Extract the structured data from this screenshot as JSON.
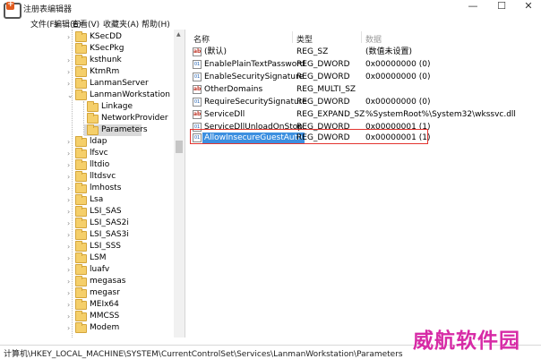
{
  "window": {
    "title": "注册表编辑器",
    "minimize_glyph": "—",
    "maximize_glyph": "☐",
    "close_glyph": "✕"
  },
  "menu": [
    "文件(F)",
    "编辑(E)",
    "查看(V)",
    "收藏夹(A)",
    "帮助(H)"
  ],
  "tree": {
    "nodes": [
      {
        "label": "KSecDD",
        "expander": "›"
      },
      {
        "label": "KSecPkg",
        "expander": ""
      },
      {
        "label": "ksthunk",
        "expander": "›"
      },
      {
        "label": "KtmRm",
        "expander": "›"
      },
      {
        "label": "LanmanServer",
        "expander": "›"
      },
      {
        "label": "LanmanWorkstation",
        "expander": "⌄"
      },
      {
        "label": "Linkage",
        "expander": ""
      },
      {
        "label": "NetworkProvider",
        "expander": ""
      },
      {
        "label": "Parameters",
        "expander": ""
      },
      {
        "label": "ldap",
        "expander": "›"
      },
      {
        "label": "lfsvc",
        "expander": "›"
      },
      {
        "label": "lltdio",
        "expander": "›"
      },
      {
        "label": "lltdsvc",
        "expander": "›"
      },
      {
        "label": "lmhosts",
        "expander": "›"
      },
      {
        "label": "Lsa",
        "expander": "›"
      },
      {
        "label": "LSI_SAS",
        "expander": "›"
      },
      {
        "label": "LSI_SAS2i",
        "expander": "›"
      },
      {
        "label": "LSI_SAS3i",
        "expander": "›"
      },
      {
        "label": "LSI_SSS",
        "expander": "›"
      },
      {
        "label": "LSM",
        "expander": "›"
      },
      {
        "label": "luafv",
        "expander": "›"
      },
      {
        "label": "megasas",
        "expander": "›"
      },
      {
        "label": "megasr",
        "expander": "›"
      },
      {
        "label": "MEIx64",
        "expander": "›"
      },
      {
        "label": "MMCSS",
        "expander": "›"
      },
      {
        "label": "Modem",
        "expander": "›"
      }
    ]
  },
  "list": {
    "headers": {
      "name": "名称",
      "type": "类型",
      "data": "数据"
    },
    "rows": [
      {
        "icon": "ab",
        "name": "(默认)",
        "type": "REG_SZ",
        "data": "(数值未设置)"
      },
      {
        "icon": "bin",
        "name": "EnablePlainTextPassword",
        "type": "REG_DWORD",
        "data": "0x00000000 (0)"
      },
      {
        "icon": "bin",
        "name": "EnableSecuritySignature",
        "type": "REG_DWORD",
        "data": "0x00000000 (0)"
      },
      {
        "icon": "ab",
        "name": "OtherDomains",
        "type": "REG_MULTI_SZ",
        "data": ""
      },
      {
        "icon": "bin",
        "name": "RequireSecuritySignature",
        "type": "REG_DWORD",
        "data": "0x00000000 (0)"
      },
      {
        "icon": "ab",
        "name": "ServiceDll",
        "type": "REG_EXPAND_SZ",
        "data": "%SystemRoot%\\System32\\wkssvc.dll"
      },
      {
        "icon": "bin",
        "name": "ServiceDllUnloadOnStop",
        "type": "REG_DWORD",
        "data": "0x00000001 (1)"
      },
      {
        "icon": "bin",
        "name": "AllowInsecureGuestAuth",
        "type": "REG_DWORD",
        "data": "0x00000001 (1)"
      }
    ]
  },
  "status": {
    "path": "计算机\\HKEY_LOCAL_MACHINE\\SYSTEM\\CurrentControlSet\\Services\\LanmanWorkstation\\Parameters"
  },
  "watermark": "威航软件园",
  "colors": {
    "highlight": "#3c8fe0",
    "annotation_box": "#e3342f",
    "watermark": "#d72ba6",
    "folder": "#f5cf6a"
  }
}
